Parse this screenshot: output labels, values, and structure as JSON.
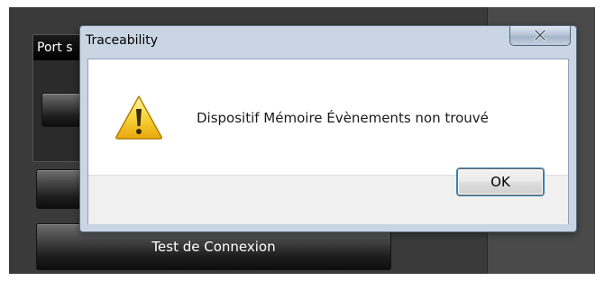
{
  "background_app": {
    "group_header": "Port s",
    "test_connection_button": "Test de Connexion"
  },
  "dialog": {
    "title": "Traceability",
    "close_symbol": "x",
    "message": "Dispositif Mémoire Évènements non trouvé",
    "ok_label": "OK",
    "icon": "warning-icon"
  },
  "colors": {
    "app_background": "#3a3a3a",
    "dialog_frame": "#c9d5e3",
    "warning_yellow": "#f5c518",
    "focus_blue": "#3c7fb1"
  }
}
